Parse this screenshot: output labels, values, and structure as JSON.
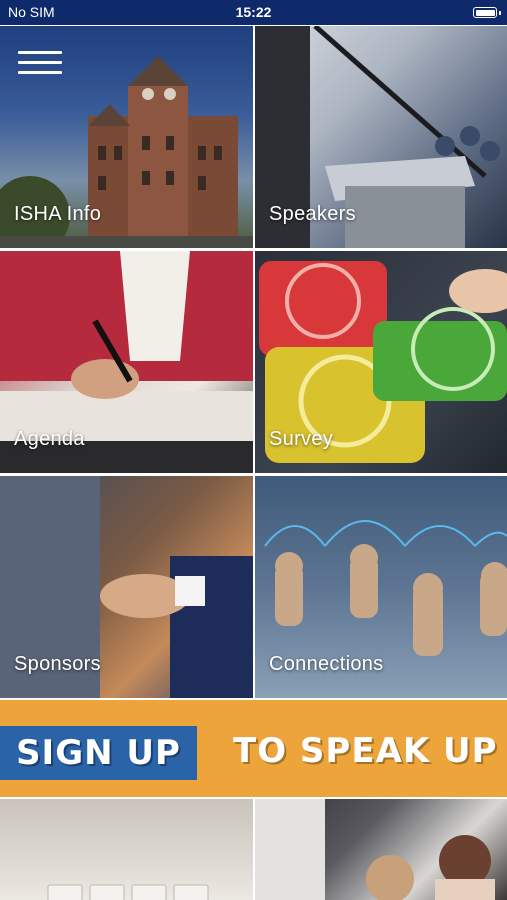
{
  "status_bar": {
    "carrier": "No SIM",
    "time": "15:22"
  },
  "menu": {
    "icon": "hamburger-menu-icon"
  },
  "tiles": [
    {
      "label": "ISHA Info"
    },
    {
      "label": "Speakers"
    },
    {
      "label": "Agenda"
    },
    {
      "label": "Survey"
    },
    {
      "label": "Sponsors"
    },
    {
      "label": "Connections"
    }
  ],
  "banner": {
    "left_text": "SIGN UP",
    "right_text": "TO SPEAK UP",
    "background": "#eda43a",
    "accent": "#2a63a8"
  },
  "colors": {
    "status_bar": "#0e2a6a"
  }
}
